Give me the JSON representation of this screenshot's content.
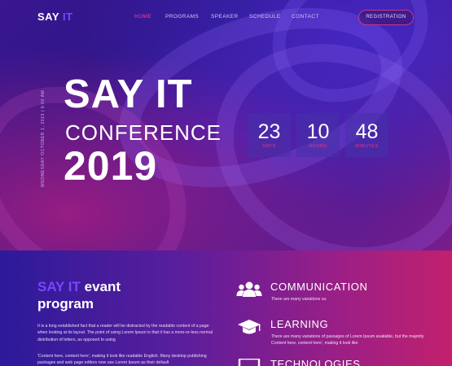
{
  "nav": {
    "logo_main": "SAY",
    "logo_accent": "IT",
    "items": [
      "HOME",
      "PROGRAMS",
      "SPEAKER",
      "SCHEDULE",
      "CONTACT"
    ],
    "active_item": "HOME",
    "registration_label": "REGISTRATION"
  },
  "hero": {
    "side_date": "WEDNESDAY OCTOBER 1, 2019 | 6:00 AM",
    "title_line1": "SAY IT",
    "title_line2": "CONFERENCE",
    "title_line3": "2019",
    "countdown": [
      {
        "value": "23",
        "label": "DAYS"
      },
      {
        "value": "10",
        "label": "HOURS"
      },
      {
        "value": "48",
        "label": "MINUTES"
      }
    ]
  },
  "program": {
    "title_accent": "SAY IT",
    "title_rest": "evant",
    "title_line2": "program",
    "paragraph1": "It is a long established fact that a reader will be distracted by the readable content of a page when looking at its layout. The point of using Lorem Ipsum is that it has a more-or-less normal distribution of letters, as opposed to using",
    "paragraph2": "'Content here, content here', making it look like readable English. Many desktop publishing packages and web page editors now use Lorem Ipsum as their default"
  },
  "features": [
    {
      "icon": "users-icon",
      "title": "COMMUNICATION",
      "desc": "There are many variations ou"
    },
    {
      "icon": "graduation-cap-icon",
      "title": "LEARNING",
      "desc": "There are many variations of passages of Lorem Ipsum available, but the majority Content here, content here', making it look like"
    },
    {
      "icon": "laptop-icon",
      "title": "TECHNOLOGIES",
      "desc": ""
    }
  ],
  "colors": {
    "accent_purple": "#7a46ff",
    "accent_pink": "#e33b86",
    "active_nav": "#ff3f8e"
  }
}
